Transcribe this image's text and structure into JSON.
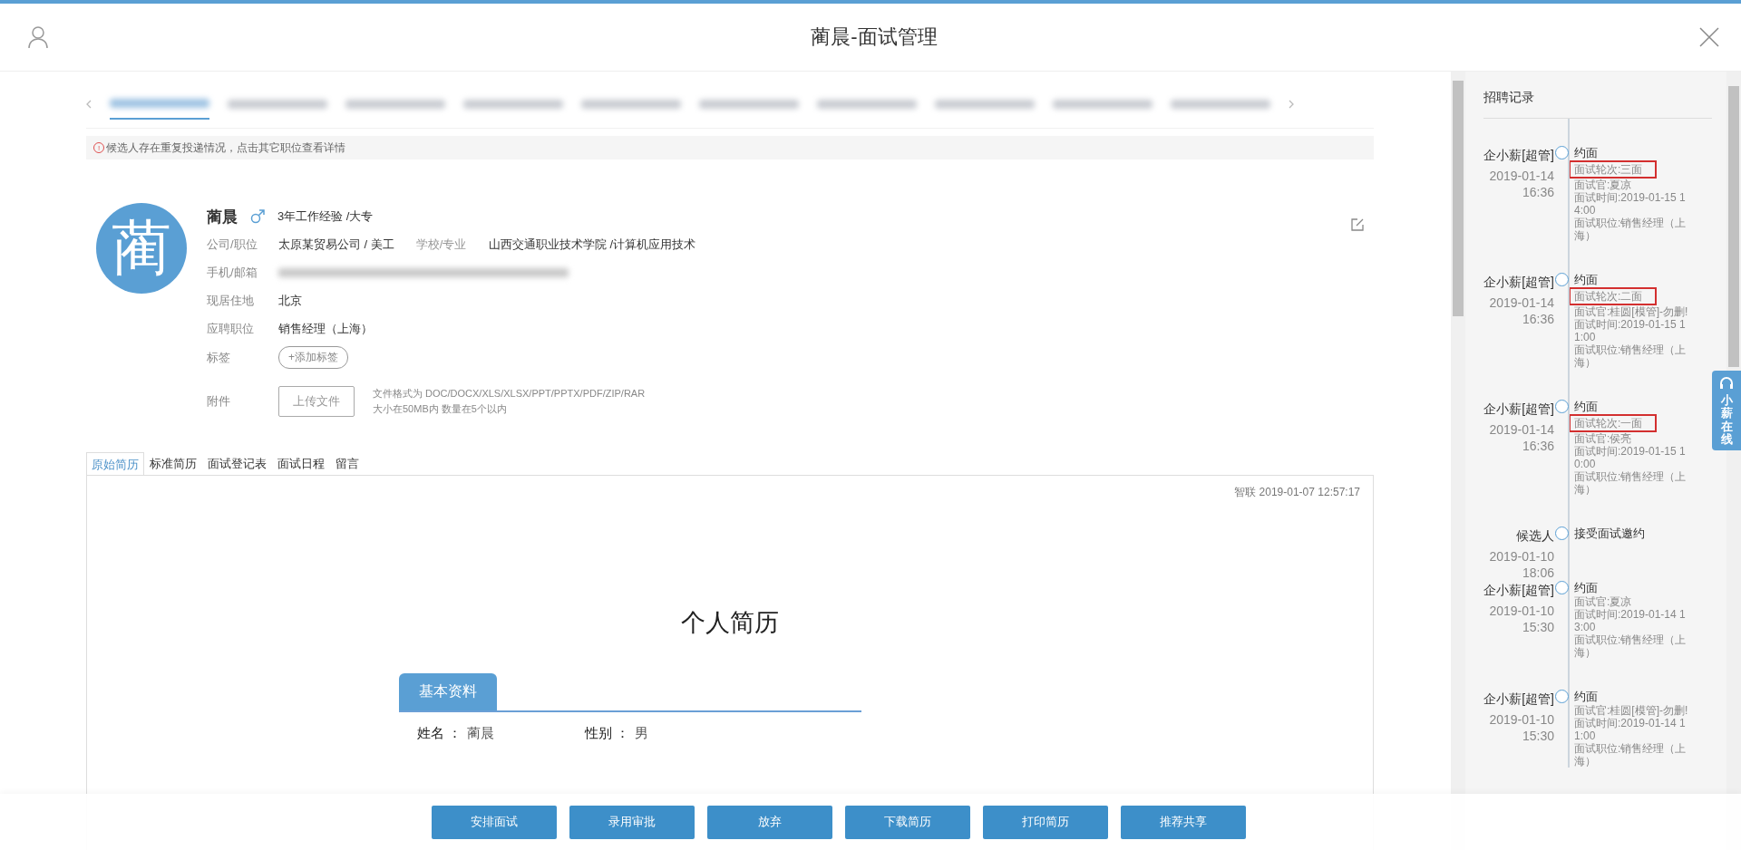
{
  "window": {
    "title": "蔺晨-面试管理"
  },
  "position_tabs": [
    {
      "selected": true
    },
    {
      "selected": false
    },
    {
      "selected": false
    },
    {
      "selected": false
    },
    {
      "selected": false
    },
    {
      "selected": false
    },
    {
      "selected": false
    },
    {
      "selected": false
    },
    {
      "selected": false
    },
    {
      "selected": false
    }
  ],
  "notice": {
    "icon": "!",
    "text": "候选人存在重复投递情况，点击其它职位查看详情"
  },
  "profile": {
    "avatar_char": "蔺",
    "name": "蔺晨",
    "summary": "3年工作经验 /大专",
    "rows": [
      {
        "label": "公司/职位",
        "value": "太原某贸易公司 / 美工",
        "label_2": "学校/专业",
        "value_2": "山西交通职业技术学院 /计算机应用技术"
      },
      {
        "label": "手机/邮箱"
      },
      {
        "label": "现居住地",
        "value": "北京"
      },
      {
        "label": "应聘职位",
        "value": "销售经理（上海）"
      }
    ],
    "tags_label": "标签",
    "add_tag": "+添加标签",
    "attachment_label": "附件",
    "upload_button": "上传文件",
    "upload_hint": [
      "文件格式为 DOC/DOCX/XLS/XLSX/PPT/PPTX/PDF/ZIP/RAR",
      "大小在50MB内 数量在5个以内"
    ]
  },
  "resume_tabs": [
    {
      "label": "原始简历",
      "selected": true
    },
    {
      "label": "标准简历",
      "selected": false
    },
    {
      "label": "面试登记表",
      "selected": false
    },
    {
      "label": "面试日程",
      "selected": false
    },
    {
      "label": "留言",
      "selected": false
    }
  ],
  "resume": {
    "source": "智联 2019-01-07 12:57:17",
    "title": "个人简历",
    "section": "基本资料",
    "fields": [
      {
        "label": "姓名 ：",
        "value": "蔺晨"
      },
      {
        "label": "性别 ：",
        "value": "男"
      }
    ]
  },
  "actions": [
    "安排面试",
    "录用审批",
    "放弃",
    "下载简历",
    "打印简历",
    "推荐共享"
  ],
  "records": {
    "title": "招聘记录",
    "entries": [
      {
        "author": "企小薪[超管]",
        "time": "2019-01-14 16:36",
        "action": "约面",
        "round": "面试轮次:三面",
        "details": [
          "面试官:夏凉",
          "面试时间:2019-01-15 14:00",
          "面试职位:销售经理（上海）"
        ]
      },
      {
        "author": "企小薪[超管]",
        "time": "2019-01-14 16:36",
        "action": "约面",
        "round": "面试轮次:二面",
        "details": [
          "面试官:桂圆[模管]-勿删!",
          "面试时间:2019-01-15 11:00",
          "面试职位:销售经理（上海）"
        ]
      },
      {
        "author": "企小薪[超管]",
        "time": "2019-01-14 16:36",
        "action": "约面",
        "round": "面试轮次:一面",
        "details": [
          "面试官:侯亮",
          "面试时间:2019-01-15 10:00",
          "面试职位:销售经理（上海）"
        ]
      },
      {
        "author": "候选人",
        "time": "2019-01-10 18:06",
        "action": "接受面试邀约"
      },
      {
        "author": "企小薪[超管]",
        "time": "2019-01-10 15:30",
        "action": "约面",
        "details": [
          "面试官:夏凉",
          "面试时间:2019-01-14 13:00",
          "面试职位:销售经理（上海）"
        ]
      },
      {
        "author": "企小薪[超管]",
        "time": "2019-01-10 15:30",
        "action": "约面",
        "details": [
          "面试官:桂圆[模管]-勿删!",
          "面试时间:2019-01-14 11:00",
          "面试职位:销售经理（上海）"
        ]
      }
    ]
  },
  "chat_widget": {
    "label": "小薪在线"
  }
}
